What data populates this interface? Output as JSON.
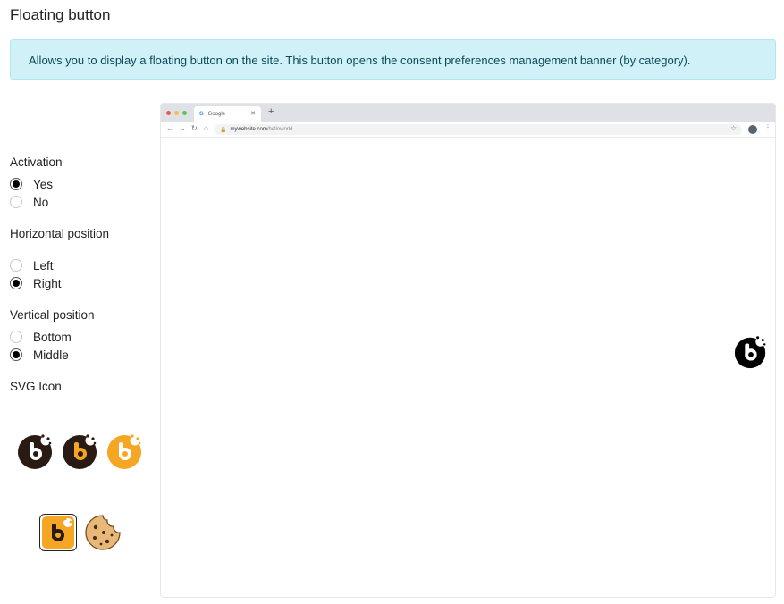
{
  "page": {
    "title": "Floating button",
    "info": "Allows you to display a floating button on the site. This button opens the consent preferences management banner (by category)."
  },
  "activation": {
    "label": "Activation",
    "options": [
      {
        "label": "Yes",
        "checked": true
      },
      {
        "label": "No",
        "checked": false
      }
    ]
  },
  "horizontal": {
    "label": "Horizontal position",
    "options": [
      {
        "label": "Left",
        "checked": false
      },
      {
        "label": "Right",
        "checked": true
      }
    ]
  },
  "vertical": {
    "label": "Vertical position",
    "options": [
      {
        "label": "Bottom",
        "checked": false
      },
      {
        "label": "Middle",
        "checked": true
      }
    ]
  },
  "svg_icon": {
    "label": "SVG Icon",
    "icons": [
      {
        "name": "b-cookie-dark-icon",
        "selected": false
      },
      {
        "name": "b-cookie-dark-orange-icon",
        "selected": false
      },
      {
        "name": "b-cookie-orange-icon",
        "selected": false
      },
      {
        "name": "b-cookie-orange-square-icon",
        "selected": true
      },
      {
        "name": "cookie-icon",
        "selected": false
      }
    ]
  },
  "preview": {
    "tab_title": "Google",
    "tab_favicon": "G",
    "url_host": "mywebsite.com",
    "url_path": "/helloworld",
    "floating_icon": "b-cookie-black-icon"
  },
  "colors": {
    "info_bg": "#d1f1f9",
    "orange": "#f5a623",
    "dark": "#2a1a14"
  }
}
